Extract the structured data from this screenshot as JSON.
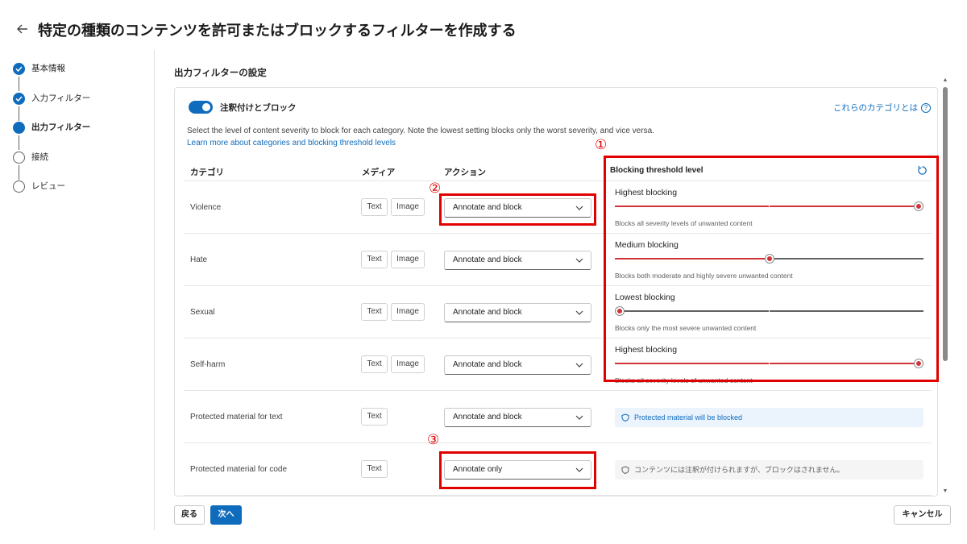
{
  "header": {
    "title": "特定の種類のコンテンツを許可またはブロックするフィルターを作成する"
  },
  "stepper": {
    "steps": [
      {
        "label": "基本情報",
        "state": "done"
      },
      {
        "label": "入力フィルター",
        "state": "done"
      },
      {
        "label": "出力フィルター",
        "state": "active"
      },
      {
        "label": "接続",
        "state": "pending"
      },
      {
        "label": "レビュー",
        "state": "pending"
      }
    ]
  },
  "section": {
    "title": "出力フィルターの設定"
  },
  "panel": {
    "toggle_label": "注釈付けとブロック",
    "toggle_on": true,
    "help_link": "これらのカテゴリとは",
    "description": "Select the level of content severity to block for each category. Note the lowest setting blocks only the worst severity, and vice versa.",
    "learn_more": "Learn more about categories and blocking threshold levels",
    "columns": {
      "category": "カテゴリ",
      "media": "メディア",
      "action": "アクション",
      "threshold": "Blocking threshold level"
    }
  },
  "rows": [
    {
      "category": "Violence",
      "media": [
        "Text",
        "Image"
      ],
      "action": "Annotate and block",
      "threshold": {
        "title": "Highest blocking",
        "level": 1.0,
        "desc": "Blocks all severity levels of unwanted content"
      }
    },
    {
      "category": "Hate",
      "media": [
        "Text",
        "Image"
      ],
      "action": "Annotate and block",
      "threshold": {
        "title": "Medium blocking",
        "level": 0.5,
        "desc": "Blocks both moderate and highly severe unwanted content"
      }
    },
    {
      "category": "Sexual",
      "media": [
        "Text",
        "Image"
      ],
      "action": "Annotate and block",
      "threshold": {
        "title": "Lowest blocking",
        "level": 0.0,
        "desc": "Blocks only the most severe unwanted content"
      }
    },
    {
      "category": "Self-harm",
      "media": [
        "Text",
        "Image"
      ],
      "action": "Annotate and block",
      "threshold": {
        "title": "Highest blocking",
        "level": 1.0,
        "desc": "Blocks all severity levels of unwanted content"
      }
    },
    {
      "category": "Protected material for text",
      "media": [
        "Text"
      ],
      "action": "Annotate and block",
      "info": "Protected material will be blocked"
    },
    {
      "category": "Protected material for code",
      "media": [
        "Text"
      ],
      "action": "Annotate only",
      "info": "コンテンツには注釈が付けられますが、ブロックはされません。"
    }
  ],
  "callouts": [
    "①",
    "②",
    "③"
  ],
  "footer": {
    "back": "戻る",
    "next": "次へ",
    "cancel": "キャンセル"
  },
  "colors": {
    "accent": "#0f6cbd",
    "slider_fill": "#d13438",
    "callout_red": "#e00000"
  }
}
